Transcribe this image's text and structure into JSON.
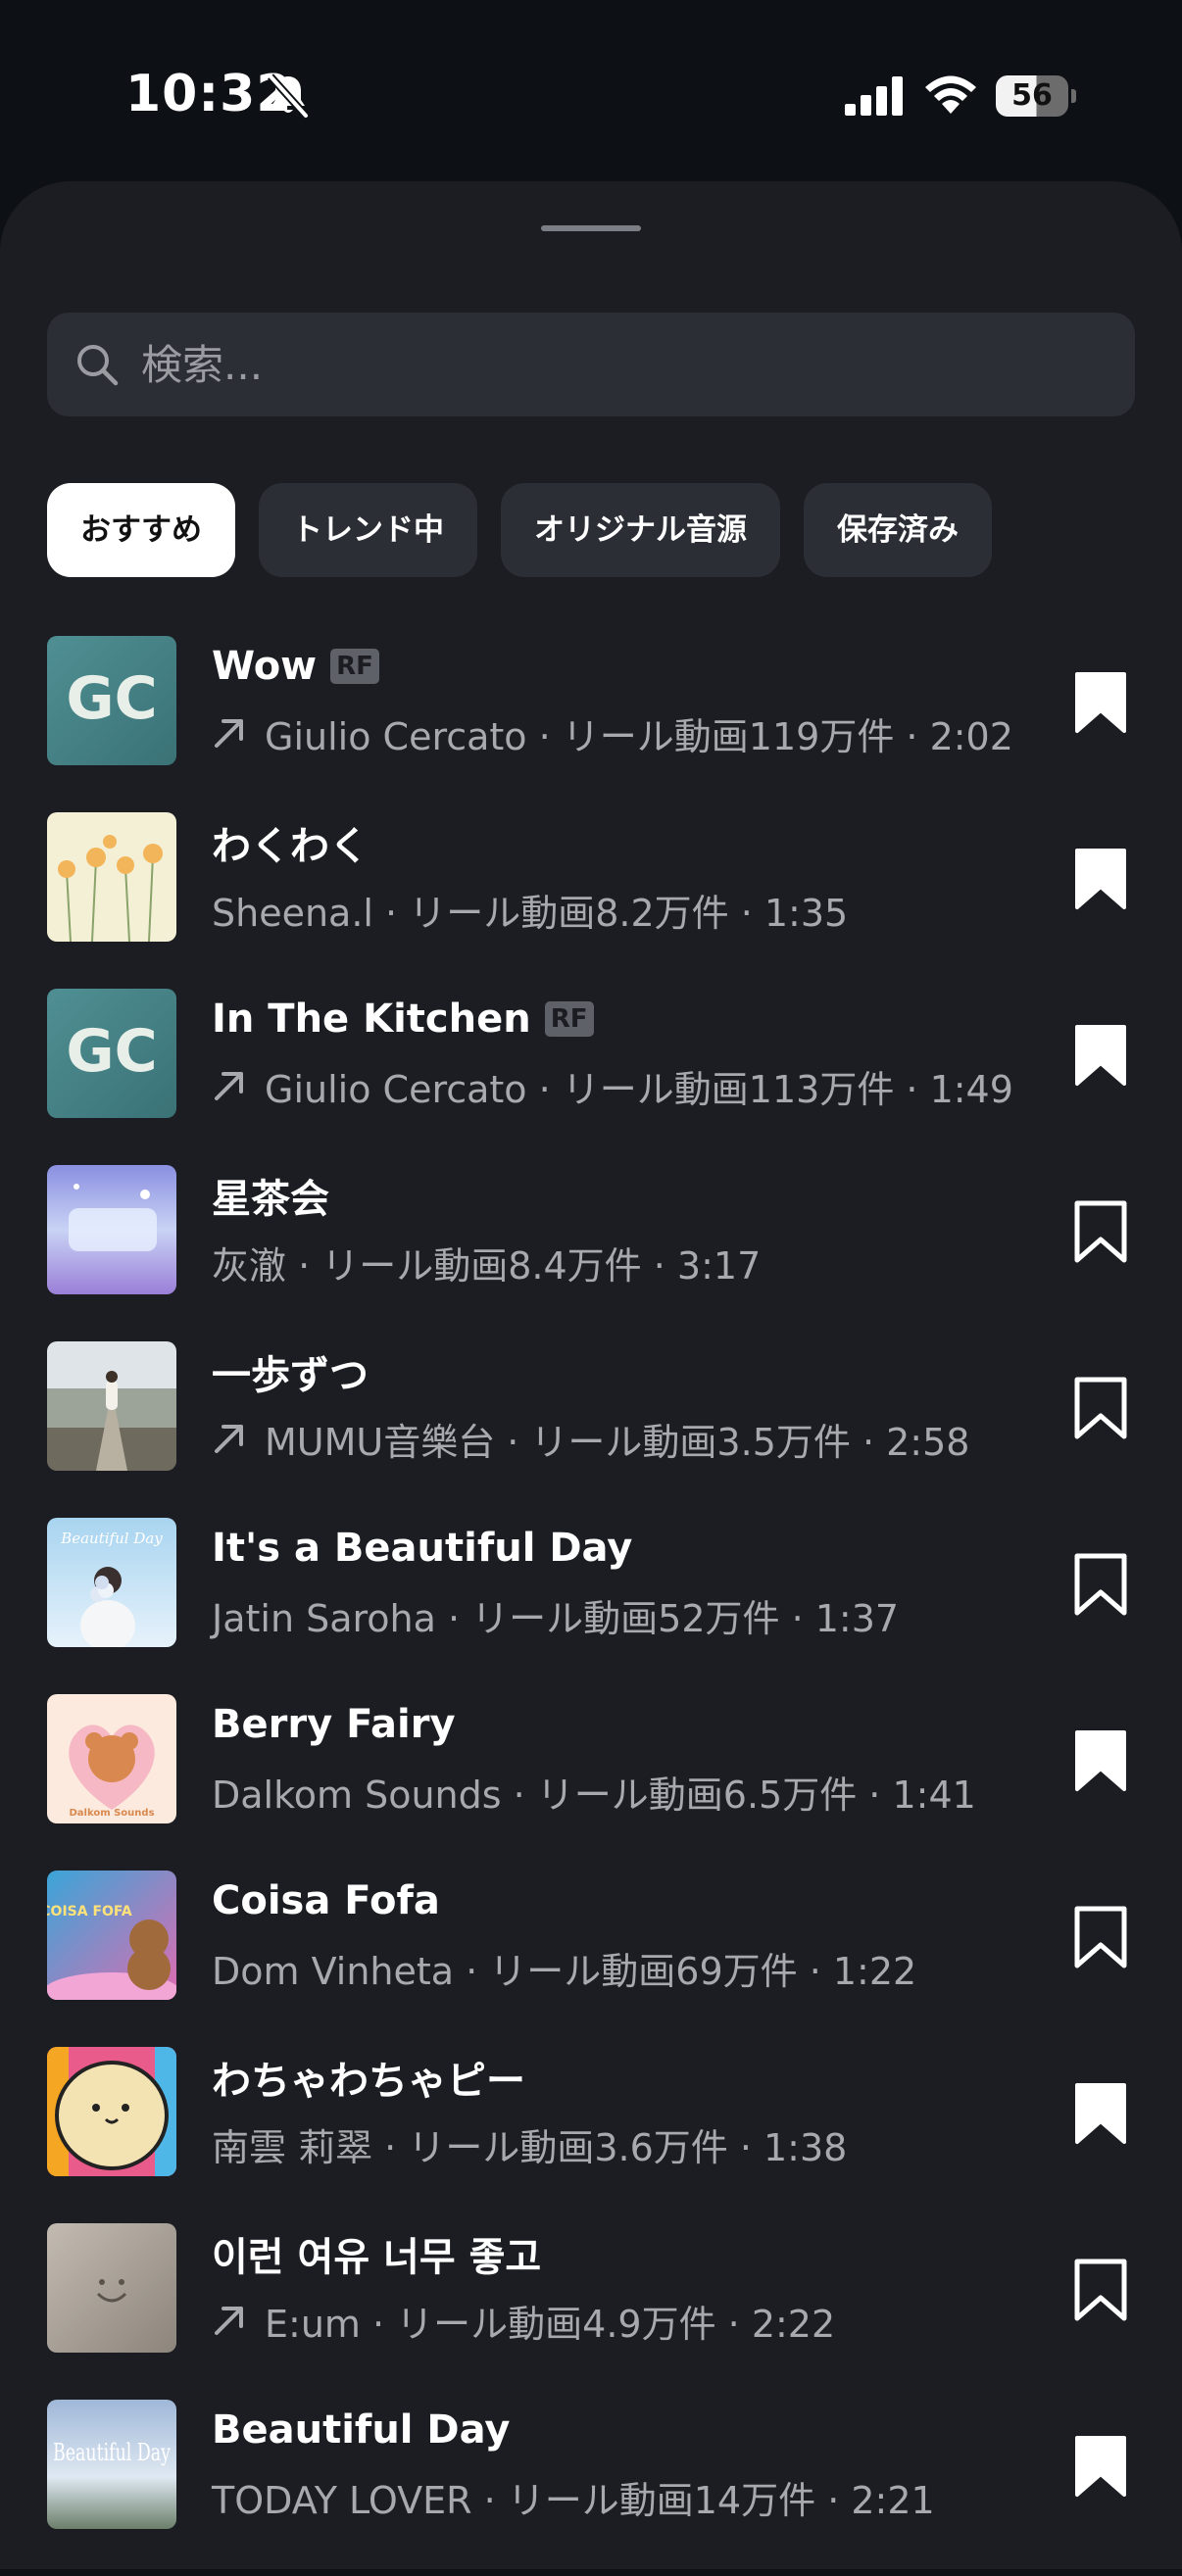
{
  "status_bar": {
    "time": "10:32",
    "battery": "56"
  },
  "search": {
    "placeholder": "検索..."
  },
  "tabs": [
    {
      "label": "おすすめ",
      "active": true
    },
    {
      "label": "トレンド中",
      "active": false
    },
    {
      "label": "オリジナル音源",
      "active": false
    },
    {
      "label": "保存済み",
      "active": false
    }
  ],
  "tracks": [
    {
      "title": "Wow",
      "rf": "RF",
      "trending": true,
      "meta": "Giulio Cercato · リール動画119万件 · 2:02",
      "saved": true
    },
    {
      "title": "わくわく",
      "rf": "",
      "trending": false,
      "meta": "Sheena.l · リール動画8.2万件 · 1:35",
      "saved": true
    },
    {
      "title": "In The Kitchen",
      "rf": "RF",
      "trending": true,
      "meta": "Giulio Cercato · リール動画113万件 · 1:49",
      "saved": true
    },
    {
      "title": "星茶会",
      "rf": "",
      "trending": false,
      "meta": "灰澈 · リール動画8.4万件 · 3:17",
      "saved": false
    },
    {
      "title": "一歩ずつ",
      "rf": "",
      "trending": true,
      "meta": "MUMU音樂台 · リール動画3.5万件 · 2:58",
      "saved": false
    },
    {
      "title": "It's a Beautiful Day",
      "rf": "",
      "trending": false,
      "meta": "Jatin Saroha · リール動画52万件 · 1:37",
      "saved": false
    },
    {
      "title": "Berry Fairy",
      "rf": "",
      "trending": false,
      "meta": "Dalkom Sounds · リール動画6.5万件 · 1:41",
      "saved": true
    },
    {
      "title": "Coisa Fofa",
      "rf": "",
      "trending": false,
      "meta": "Dom Vinheta · リール動画69万件 · 1:22",
      "saved": false
    },
    {
      "title": "わちゃわちゃピー",
      "rf": "",
      "trending": false,
      "meta": "南雲 莉翠 · リール動画3.6万件 · 1:38",
      "saved": true
    },
    {
      "title": "이런 여유 너무 좋고",
      "rf": "",
      "trending": true,
      "meta": "E:um · リール動画4.9万件 · 2:22",
      "saved": false
    },
    {
      "title": "Beautiful Day",
      "rf": "",
      "trending": false,
      "meta": "TODAY LOVER · リール動画14万件 · 2:21",
      "saved": true
    }
  ],
  "artwork": {
    "wow_logo": "GC",
    "beautiful_day_text": "Beautiful Day",
    "berry_fairy_text": "Dalkom Sounds",
    "coisa_fofa_text": "COISA FOFA",
    "beautiful_day_2_text": "Beautiful Day"
  },
  "colors": {
    "background": "#0d1015",
    "sheet": "#1b1d22",
    "chip": "#2b2e35",
    "secondary_text": "#a7a9ae"
  }
}
